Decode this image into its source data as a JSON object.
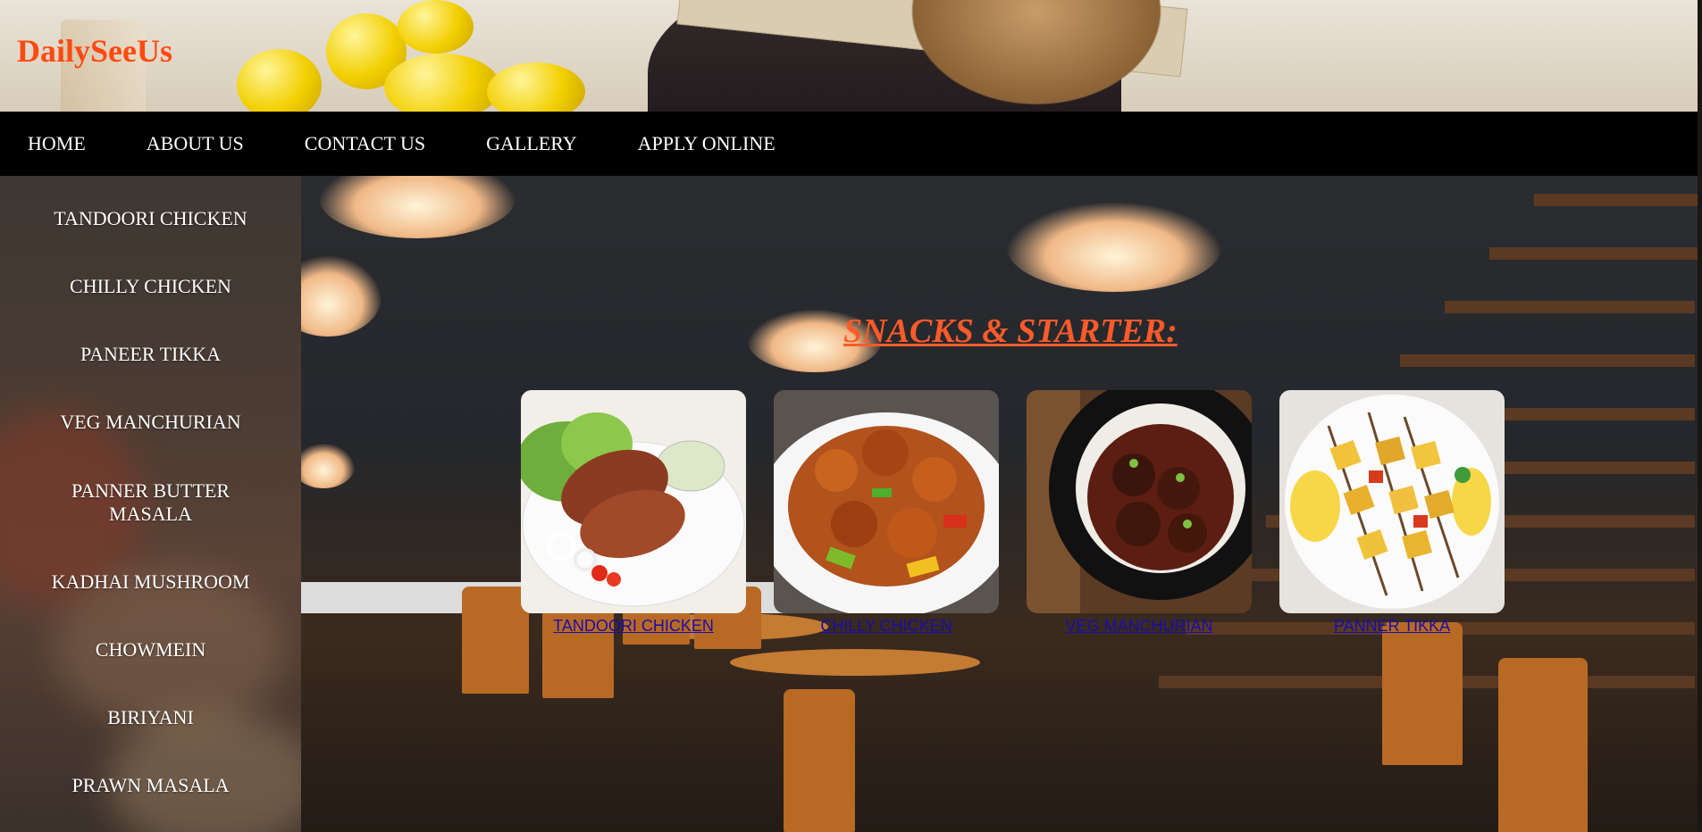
{
  "brand": {
    "name": "DailySeeUs",
    "color": "#ff4a12"
  },
  "nav": {
    "items": [
      {
        "label": "HOME"
      },
      {
        "label": "ABOUT US"
      },
      {
        "label": "CONTACT US"
      },
      {
        "label": "GALLERY"
      },
      {
        "label": "APPLY ONLINE"
      }
    ]
  },
  "sidebar": {
    "items": [
      {
        "label": "TANDOORI CHICKEN"
      },
      {
        "label": "CHILLY CHICKEN"
      },
      {
        "label": "PANEER TIKKA"
      },
      {
        "label": "VEG MANCHURIAN"
      },
      {
        "label": "PANNER BUTTER MASALA"
      },
      {
        "label": "KADHAI MUSHROOM"
      },
      {
        "label": "CHOWMEIN"
      },
      {
        "label": "BIRIYANI"
      },
      {
        "label": "PRAWN MASALA"
      }
    ]
  },
  "main": {
    "section_title": "SNACKS & STARTER:",
    "section_title_color": "#ff5a2a",
    "dishes": [
      {
        "caption": "TANDOORI CHICKEN",
        "icon": "tandoori-chicken-photo"
      },
      {
        "caption": "CHILLY CHICKEN",
        "icon": "chilly-chicken-photo"
      },
      {
        "caption": "VEG MANCHURIAN",
        "icon": "veg-manchurian-photo"
      },
      {
        "caption": "PANNER TIKKA",
        "icon": "paneer-tikka-photo"
      }
    ]
  }
}
